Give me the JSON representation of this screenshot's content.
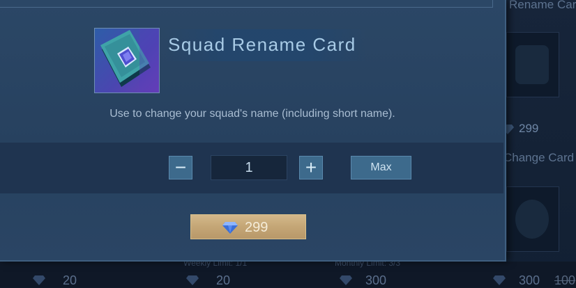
{
  "dialog": {
    "item_name": "Squad Rename Card",
    "description": "Use to change your squad's name (including short name).",
    "quantity": "1",
    "minus_label": "−",
    "plus_label": "+",
    "max_label": "Max",
    "price": "299"
  },
  "background_shop": {
    "right_column": [
      {
        "label": "Rename Car",
        "price": "299"
      },
      {
        "label": "Change Card"
      }
    ],
    "limits": [
      "Weekly Limit: 1/1",
      "Monthly Limit: 3/3"
    ],
    "bottom_prices": [
      "20",
      "20",
      "300",
      "300"
    ],
    "strike_price": "100"
  },
  "colors": {
    "dialog_bg": "#2a4564",
    "accent_button": "#3d6a8c",
    "buy_button": "#c4a676",
    "title_text": "#a8cbe6"
  }
}
